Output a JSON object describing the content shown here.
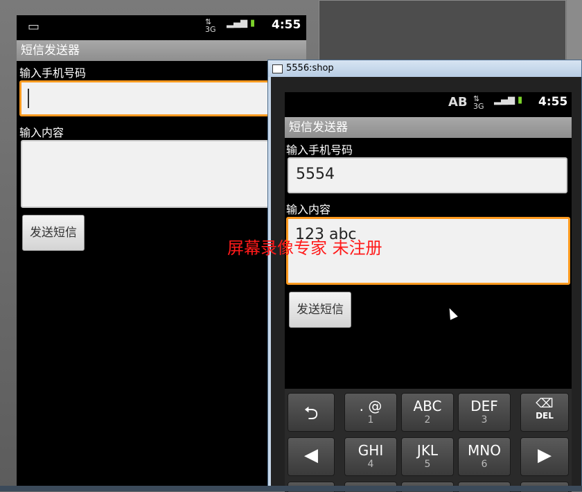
{
  "left_phone": {
    "status": {
      "time": "4:55"
    },
    "title": "短信发送器",
    "phone_label": "输入手机号码",
    "phone_value": "",
    "content_label": "输入内容",
    "content_value": "",
    "send_label": "发送短信"
  },
  "emulator_window": {
    "title": "5556:shop"
  },
  "right_phone": {
    "status": {
      "time": "4:55",
      "ime": "AB",
      "network": "3G"
    },
    "title": "短信发送器",
    "phone_label": "输入手机号码",
    "phone_value": "5554",
    "content_label": "输入内容",
    "content_value": "123 abc",
    "send_label": "发送短信"
  },
  "keyboard": {
    "row1": [
      {
        "main": "",
        "sub": "",
        "icon": "⮌",
        "name": "return-key"
      },
      {
        "main": ". @",
        "sub": "1",
        "name": "key-1"
      },
      {
        "main": "ABC",
        "sub": "2",
        "name": "key-2"
      },
      {
        "main": "DEF",
        "sub": "3",
        "name": "key-3"
      },
      {
        "main": "DEL",
        "icon": "⌫",
        "name": "delete-key"
      }
    ],
    "row2": [
      {
        "icon": "◀",
        "name": "left-arrow-key"
      },
      {
        "main": "GHI",
        "sub": "4",
        "name": "key-4"
      },
      {
        "main": "JKL",
        "sub": "5",
        "name": "key-5"
      },
      {
        "main": "MNO",
        "sub": "6",
        "name": "key-6"
      },
      {
        "icon": "▶",
        "name": "right-arrow-key"
      }
    ]
  },
  "watermark": "屏幕录像专家  未注册"
}
